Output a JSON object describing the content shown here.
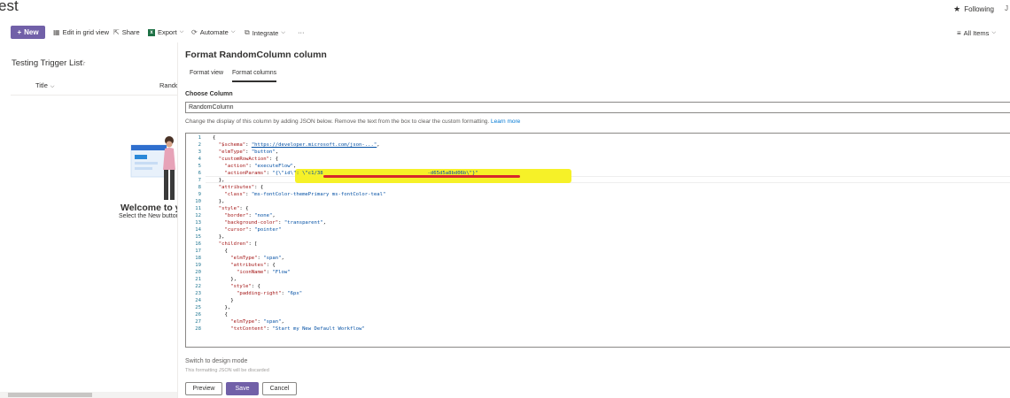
{
  "site": {
    "title": "est",
    "following_label": "Following",
    "user_initial": "J"
  },
  "commandbar": {
    "new_label": "New",
    "edit_grid_label": "Edit in grid view",
    "share_label": "Share",
    "export_label": "Export",
    "automate_label": "Automate",
    "integrate_label": "Integrate",
    "more_label": "···",
    "view_label": "All Items"
  },
  "list": {
    "title": "Testing Trigger List",
    "columns": [
      "Title",
      "Random"
    ],
    "welcome_title": "Welcome to yo",
    "welcome_sub": "Select the New button"
  },
  "panel": {
    "title": "Format RandomColumn column",
    "tabs": [
      "Format view",
      "Format columns"
    ],
    "active_tab": "Format columns",
    "choose_column_label": "Choose Column",
    "column_value": "RandomColumn",
    "help_text": "Change the display of this column by adding JSON below. Remove the text from the box to clear the custom formatting.",
    "help_link": "Learn more",
    "design_mode_link": "Switch to design mode",
    "design_mode_note": "This formatting JSON will be discarded",
    "buttons": {
      "preview": "Preview",
      "save": "Save",
      "cancel": "Cancel"
    }
  },
  "code_lines": [
    {
      "n": "1",
      "t": "{"
    },
    {
      "n": "2",
      "t": "  \"$schema\": \"https://developer.microsoft.com/json-...\","
    },
    {
      "n": "3",
      "t": "  \"elmType\": \"button\","
    },
    {
      "n": "4",
      "t": "  \"customRowAction\": {"
    },
    {
      "n": "5",
      "t": "    \"action\": \"executeFlow\","
    },
    {
      "n": "6",
      "t": "    \"actionParams\": \"{\\\"id\\\": \\\"c1/38                                   -d65d5a8bd06b\\\"}\""
    },
    {
      "n": "7",
      "t": "  },"
    },
    {
      "n": "8",
      "t": "  \"attributes\": {"
    },
    {
      "n": "9",
      "t": "    \"class\": \"ms-fontColor-themePrimary ms-fontColor-teal\""
    },
    {
      "n": "10",
      "t": "  },"
    },
    {
      "n": "11",
      "t": "  \"style\": {"
    },
    {
      "n": "12",
      "t": "    \"border\": \"none\","
    },
    {
      "n": "13",
      "t": "    \"background-color\": \"transparent\","
    },
    {
      "n": "14",
      "t": "    \"cursor\": \"pointer\""
    },
    {
      "n": "15",
      "t": "  },"
    },
    {
      "n": "16",
      "t": "  \"children\": ["
    },
    {
      "n": "17",
      "t": "    {"
    },
    {
      "n": "18",
      "t": "      \"elmType\": \"span\","
    },
    {
      "n": "19",
      "t": "      \"attributes\": {"
    },
    {
      "n": "20",
      "t": "        \"iconName\": \"Flow\""
    },
    {
      "n": "21",
      "t": "      },"
    },
    {
      "n": "22",
      "t": "      \"style\": {"
    },
    {
      "n": "23",
      "t": "        \"padding-right\": \"6px\""
    },
    {
      "n": "24",
      "t": "      }"
    },
    {
      "n": "25",
      "t": "    },"
    },
    {
      "n": "26",
      "t": "    {"
    },
    {
      "n": "27",
      "t": "      \"elmType\": \"span\","
    },
    {
      "n": "28",
      "t": "      \"txtContent\": \"Start my New Default Workflow\""
    }
  ],
  "colors": {
    "accent": "#7160a8",
    "highlight": "#f5f01c",
    "redaction": "#d7262c",
    "link": "#0078d4"
  }
}
